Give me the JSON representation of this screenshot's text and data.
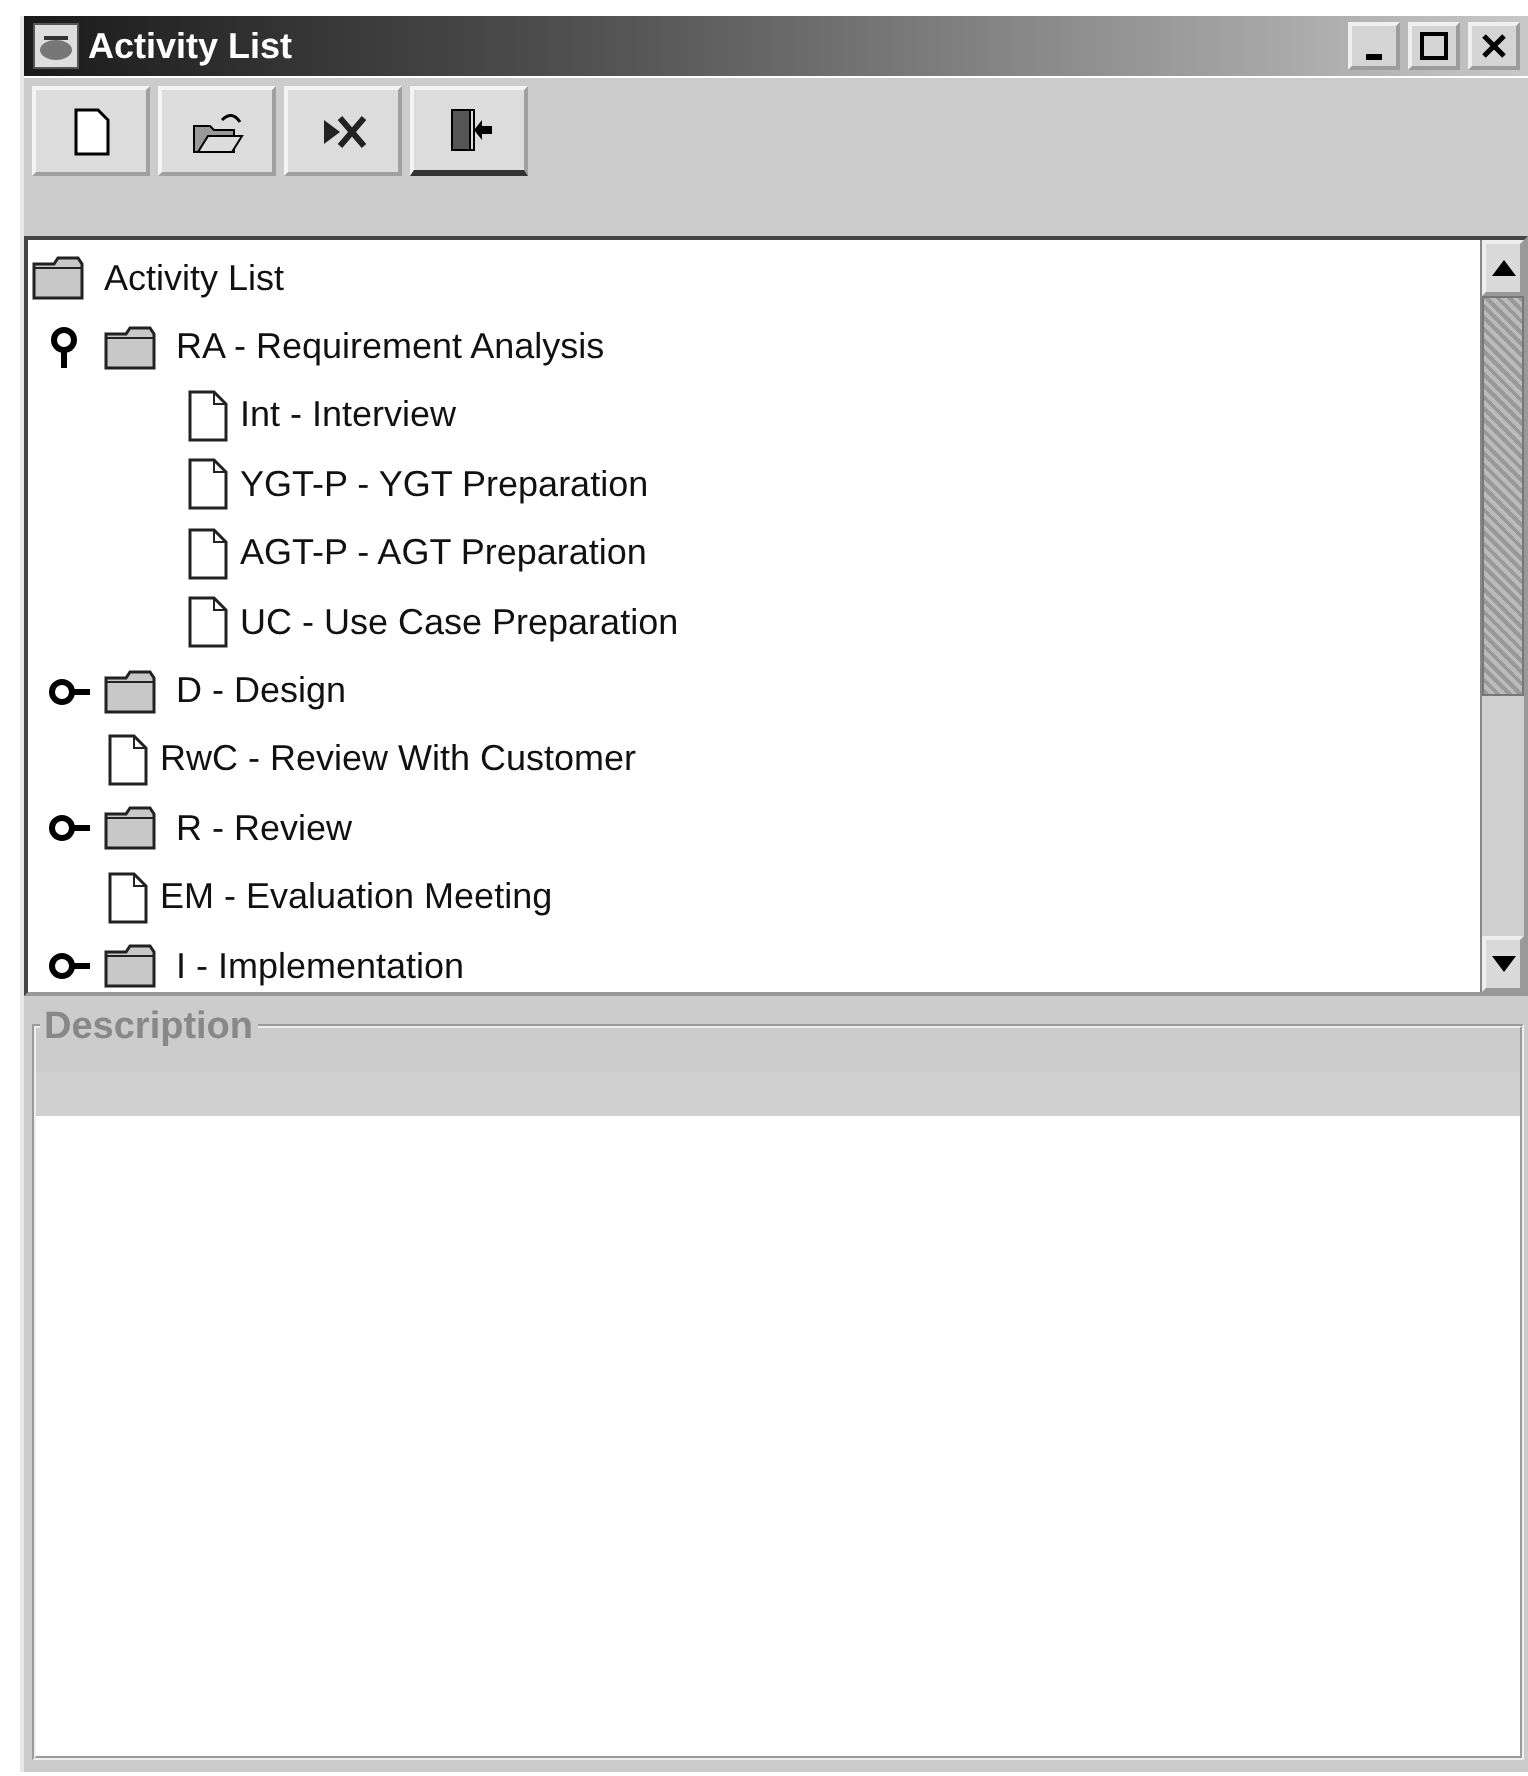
{
  "window": {
    "title": "Activity List"
  },
  "tree": {
    "label": "Activity List",
    "kind": "folder",
    "children": [
      {
        "label": "RA - Requirement Analysis",
        "kind": "folder",
        "expanded": true,
        "children": [
          {
            "label": "Int - Interview",
            "kind": "file"
          },
          {
            "label": "YGT-P - YGT Preparation",
            "kind": "file"
          },
          {
            "label": "AGT-P - AGT Preparation",
            "kind": "file"
          },
          {
            "label": "UC - Use Case Preparation",
            "kind": "file"
          }
        ]
      },
      {
        "label": "D - Design",
        "kind": "folder",
        "expanded": false
      },
      {
        "label": "RwC - Review With Customer",
        "kind": "file"
      },
      {
        "label": "R - Review",
        "kind": "folder",
        "expanded": false
      },
      {
        "label": "EM - Evaluation Meeting",
        "kind": "file"
      },
      {
        "label": "I - Implementation",
        "kind": "folder",
        "expanded": false
      }
    ]
  },
  "description": {
    "title": "Description"
  }
}
